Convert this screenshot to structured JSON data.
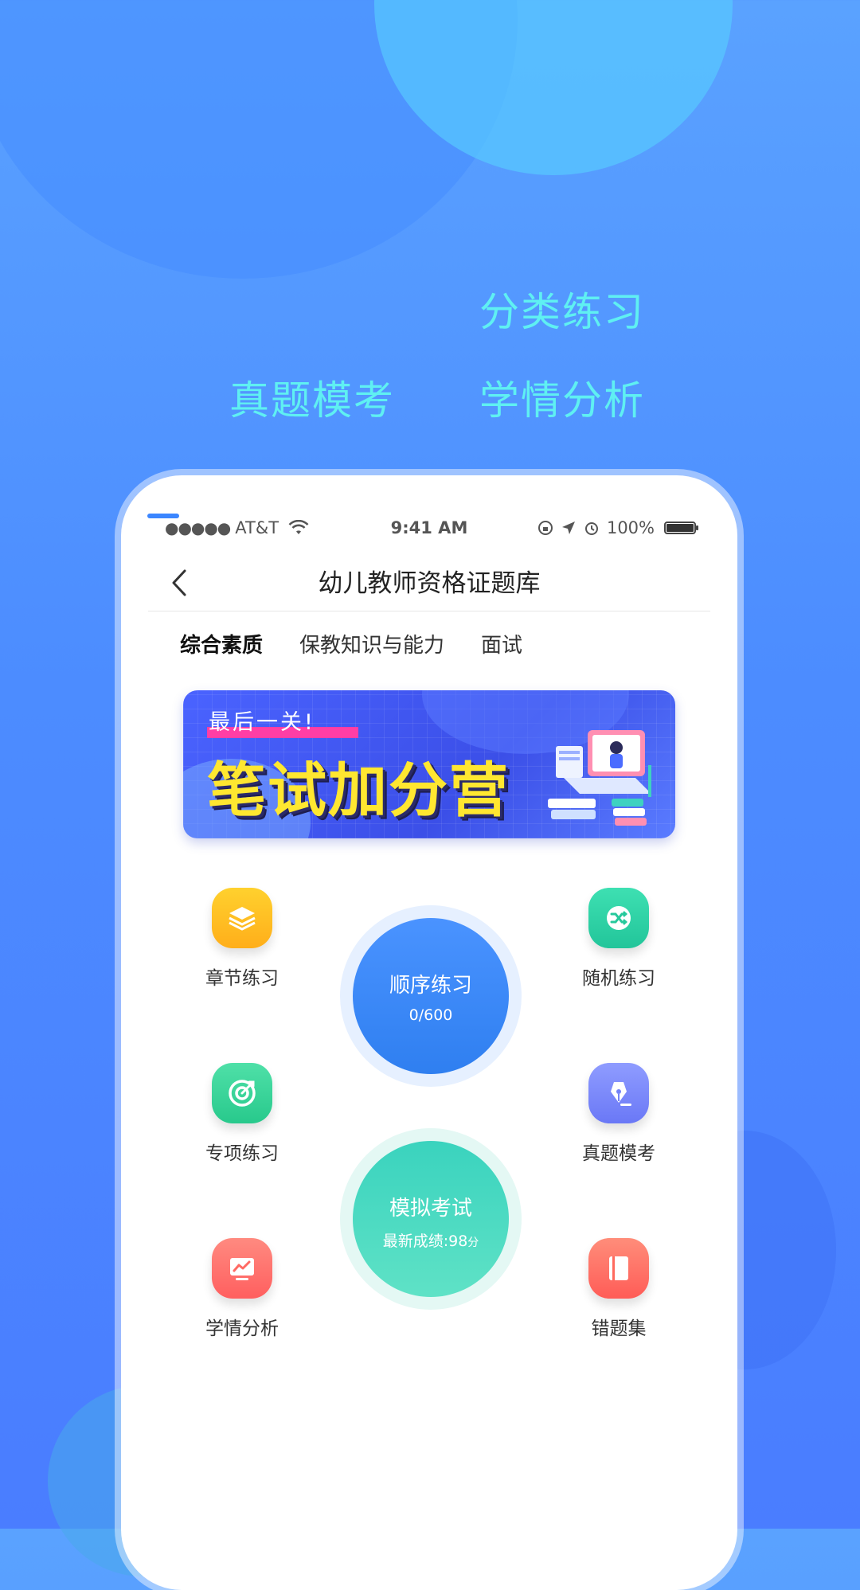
{
  "promo": {
    "line1": "分类练习",
    "line2_left": "真题模考",
    "line2_right": "学情分析",
    "color": "#5ff0f2"
  },
  "statusbar": {
    "carrier": "AT&T",
    "time": "9:41 AM",
    "battery": "100%"
  },
  "navbar": {
    "title": "幼儿教师资格证题库"
  },
  "tabs": [
    {
      "label": "综合素质",
      "active": true
    },
    {
      "label": "保教知识与能力",
      "active": false
    },
    {
      "label": "面试",
      "active": false
    }
  ],
  "banner": {
    "tag": "最后一关!",
    "main": "笔试加分营"
  },
  "features": {
    "chapter": {
      "label": "章节练习",
      "icon": "layers-icon",
      "color": "#ffc22a"
    },
    "random": {
      "label": "随机练习",
      "icon": "shuffle-icon",
      "color": "#2fd6a6"
    },
    "special": {
      "label": "专项练习",
      "icon": "target-icon",
      "color": "#36d597"
    },
    "exam": {
      "label": "真题模考",
      "icon": "pen-nib-icon",
      "color": "#7d8bfb"
    },
    "analysis": {
      "label": "学情分析",
      "icon": "chart-monitor-icon",
      "color": "#ff7470"
    },
    "mistakes": {
      "label": "错题集",
      "icon": "notebook-icon",
      "color": "#ff7569"
    }
  },
  "sequential": {
    "title": "顺序练习",
    "progress": "0/600",
    "color": "#3b86ff"
  },
  "mock": {
    "title": "模拟考试",
    "score_label": "最新成绩:",
    "score_value": "98",
    "score_unit": "分",
    "color": "#3ad3be"
  }
}
